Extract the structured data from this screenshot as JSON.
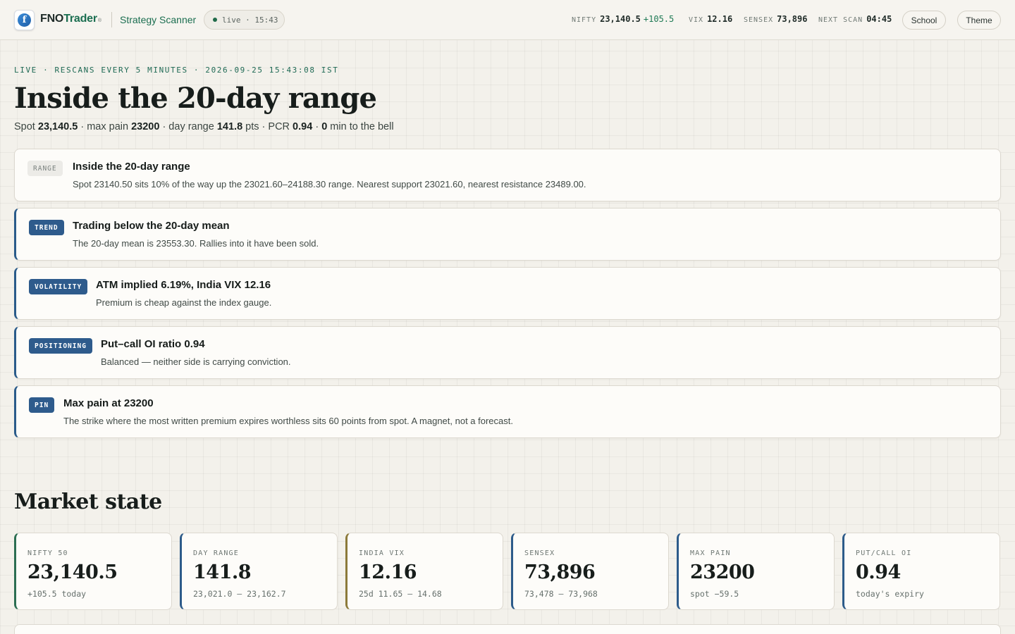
{
  "header": {
    "logo_letter": "f",
    "brand_part1": "FNO",
    "brand_part2": "Trader",
    "brand_mark": "®",
    "nav_link": "Strategy Scanner",
    "live_pill": "live · 15:43",
    "ticker": {
      "nifty_label": "NIFTY",
      "nifty_value": "23,140.5",
      "nifty_change": "+105.5",
      "vix_label": "VIX",
      "vix_value": "12.16",
      "sensex_label": "SENSEX",
      "sensex_value": "73,896",
      "next_scan_label": "NEXT SCAN",
      "next_scan_value": "04:45"
    },
    "school_button": "School",
    "theme_button": "Theme"
  },
  "hero": {
    "eyebrow": "LIVE · RESCANS EVERY 5 MINUTES · 2026-09-25 15:43:08 IST",
    "title": "Inside the 20-day range",
    "sub": {
      "spot_label": "Spot",
      "spot_value": "23,140.5",
      "maxpain_label": "· max pain",
      "maxpain_value": "23200",
      "dayrange_label": "· day range",
      "dayrange_value": "141.8",
      "dayrange_unit": "pts · PCR",
      "pcr_value": "0.94",
      "sep": "·",
      "bell_value": "0",
      "bell_label": "min to the bell"
    }
  },
  "insights": [
    {
      "tag": "RANGE",
      "title": "Inside the 20-day range",
      "text": "Spot 23140.50 sits 10% of the way up the 23021.60–24188.30 range. Nearest support 23021.60, nearest resistance 23489.00."
    },
    {
      "tag": "TREND",
      "title": "Trading below the 20-day mean",
      "text": "The 20-day mean is 23553.30. Rallies into it have been sold."
    },
    {
      "tag": "VOLATILITY",
      "title": "ATM implied 6.19%, India VIX 12.16",
      "text": "Premium is cheap against the index gauge."
    },
    {
      "tag": "POSITIONING",
      "title": "Put–call OI ratio 0.94",
      "text": "Balanced — neither side is carrying conviction."
    },
    {
      "tag": "PIN",
      "title": "Max pain at 23200",
      "text": "The strike where the most written premium expires worthless sits 60 points from spot. A magnet, not a forecast."
    }
  ],
  "market_state": {
    "title": "Market state",
    "cards": [
      {
        "label": "NIFTY 50",
        "value": "23,140.5",
        "note": "+105.5 today"
      },
      {
        "label": "DAY RANGE",
        "value": "141.8",
        "note": "23,021.0 – 23,162.7"
      },
      {
        "label": "INDIA VIX",
        "value": "12.16",
        "note": "25d 11.65 – 14.68"
      },
      {
        "label": "SENSEX",
        "value": "73,896",
        "note": "73,478 – 73,968"
      },
      {
        "label": "MAX PAIN",
        "value": "23200",
        "note": "spot −59.5"
      },
      {
        "label": "PUT/CALL OI",
        "value": "0.94",
        "note": "today's expiry"
      }
    ]
  },
  "colors": {
    "accent_green": "#1b6e50",
    "accent_blue": "#2e5b8c",
    "accent_gold": "#8c7a3a",
    "positive": "#1f7a55"
  }
}
